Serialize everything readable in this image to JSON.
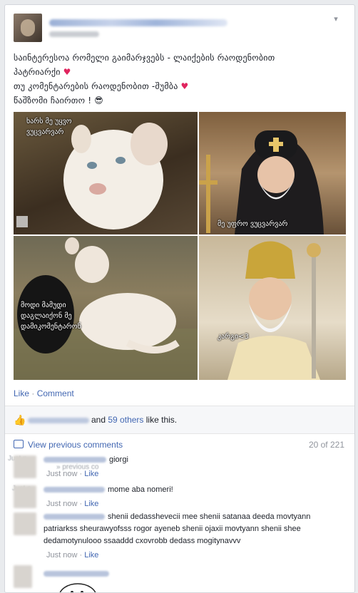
{
  "post": {
    "more_icon": "chevron-down-icon",
    "text_lines": [
      "საინტერესოა რომელი გაიმარჯვებს - ლაიქების რაოდენობით",
      "პატრიარქი",
      "თუ კომენტარების რაოდენობით -შუმბა",
      "წაშზომი ჩაირთო ! 😎"
    ],
    "heart_glyph": "♥",
    "photo_captions": {
      "top_left": [
        "ხარს მე უყვო",
        "ვუცვარვარ"
      ],
      "top_right": "მე უფრო ვუცვარვარ",
      "bottom_left": [
        "მოდი მამუდი",
        "დაგლაიქონ მე",
        "დამიკომენტარონ"
      ],
      "bottom_right": "კარგი<3"
    }
  },
  "actions": {
    "like": "Like",
    "separator": "·",
    "comment": "Comment"
  },
  "likes": {
    "and_text": "and",
    "others": "59 others",
    "suffix": "like this.",
    "icon": "thumbs-up-icon"
  },
  "comments_header": {
    "view_previous": "View previous comments",
    "count": "20 of 221",
    "icon": "comment-bubble-icon"
  },
  "comments": [
    {
      "text": "giorgi",
      "time": "Just now",
      "like": "Like",
      "faded_lines": [
        "Just n",
        "» previous co"
      ]
    },
    {
      "text": "mome aba nomeri!",
      "time": "Just now",
      "like": "Like",
      "faded_lines": [
        "Just n"
      ]
    },
    {
      "text": "shenii dedasshevecii mee shenii satanaa deeda movtyann patriarkss sheurawyofsss rogor ayeneb shenii ojaxii movtyann shenii shee dedamotynulooo ssaaddd cxovrobb dedass mogitynavvv",
      "time": "Just now",
      "like": "Like"
    }
  ],
  "separators": {
    "dot": "·"
  }
}
